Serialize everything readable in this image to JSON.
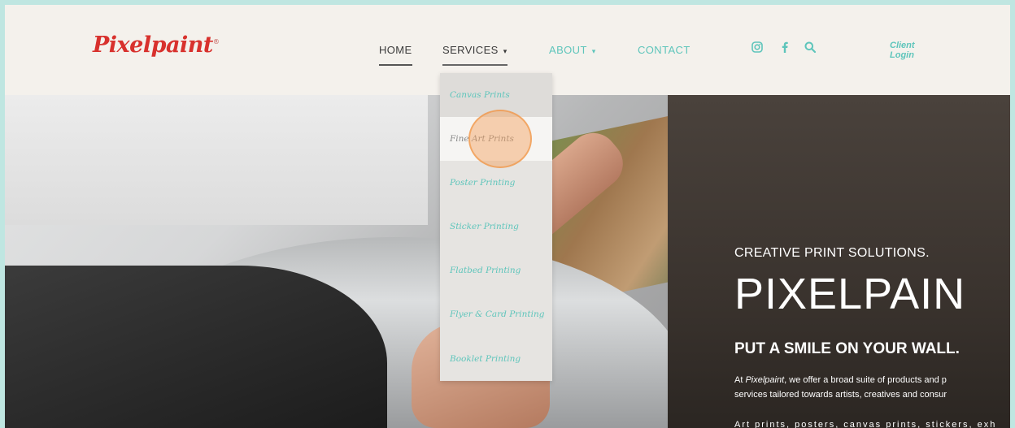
{
  "brand": {
    "name": "Pixelpaint",
    "mark": "®"
  },
  "nav": {
    "home": "HOME",
    "services": "SERVICES",
    "about": "ABOUT",
    "contact": "CONTACT",
    "caret": "▾"
  },
  "social": [
    "instagram-icon",
    "facebook-icon",
    "search-icon"
  ],
  "login": {
    "line1": "Client",
    "line2": "Login"
  },
  "services_menu": [
    "Canvas Prints",
    "Fine Art Prints",
    "Poster Printing",
    "Sticker Printing",
    "Flatbed Printing",
    "Flyer & Card Printing",
    "Booklet Printing"
  ],
  "hero": {
    "kicker": "CREATIVE PRINT SOLUTIONS.",
    "title": "PIXELPAIN",
    "tagline": "PUT A SMILE ON YOUR WALL.",
    "body_line1_pre": "At ",
    "body_line1_brand": "Pixelpaint",
    "body_line1_post": ", we offer a broad suite of products and p",
    "body_line2": "services tailored towards artists, creatives and consur",
    "body_line3": "Art prints, posters, canvas prints, stickers, exh"
  },
  "colors": {
    "accent": "#5ec5bb",
    "brand_red": "#d8312d",
    "header_bg": "#f4f1ec",
    "frame_bg": "#bfe6e1"
  }
}
